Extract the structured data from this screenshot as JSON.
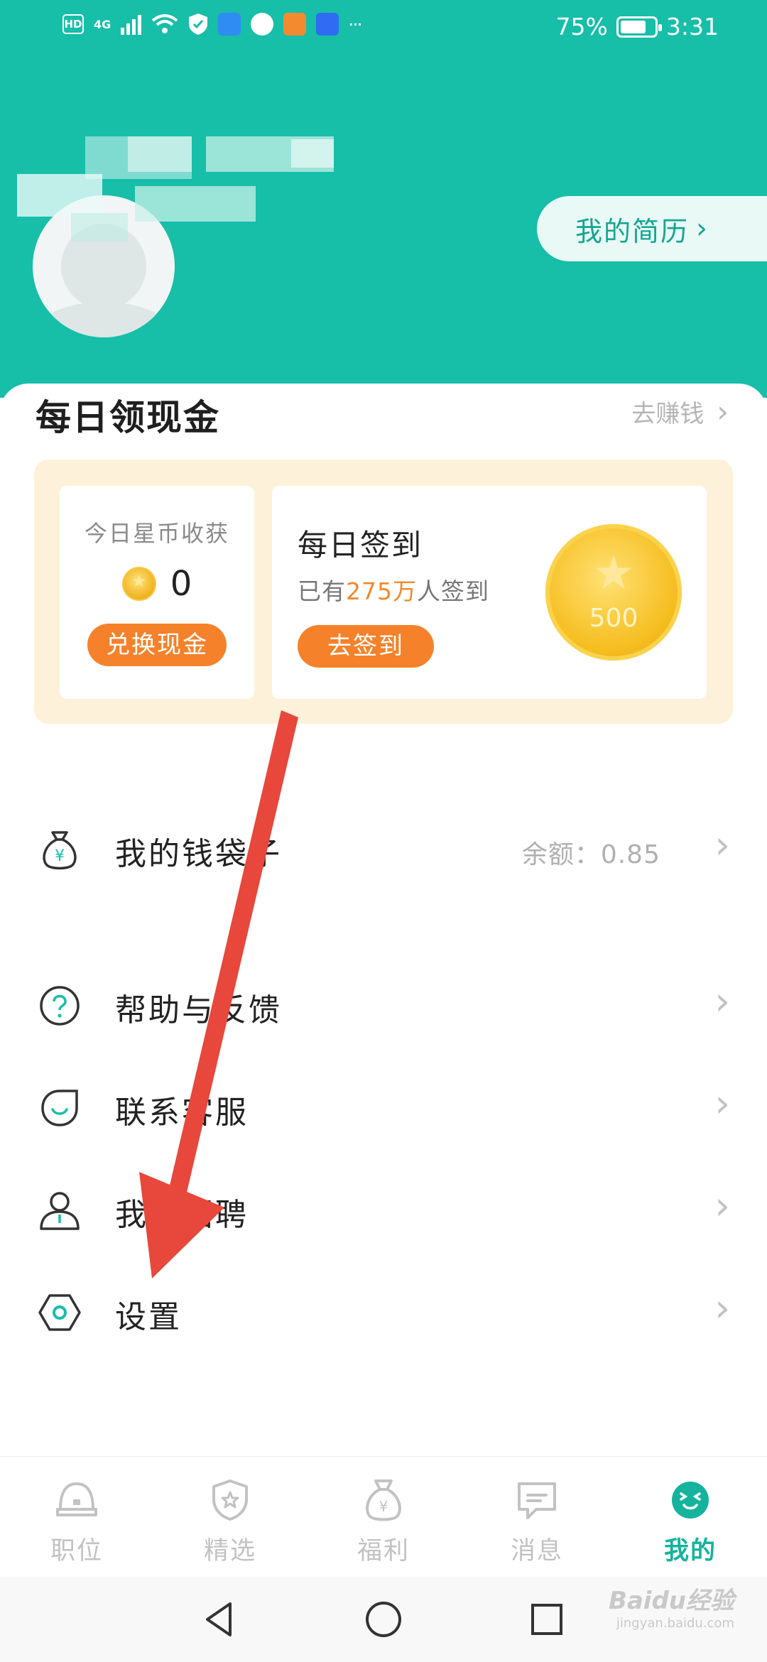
{
  "status_bar": {
    "hd": "HD",
    "net": "4G",
    "battery": "75%",
    "battery_level": 0.75,
    "time": "3:31",
    "more": "···"
  },
  "header": {
    "resume_button": "我的简历",
    "resume_chevron": "›"
  },
  "daily": {
    "title": "每日领现金",
    "earn_link": "去赚钱",
    "earn_chevron": "›",
    "today_label": "今日星币收获",
    "coins": "0",
    "exchange_button": "兑换现金",
    "checkin_title": "每日签到",
    "checkin_prefix": "已有",
    "checkin_count": "275万",
    "checkin_suffix": "人签到",
    "checkin_button": "去签到",
    "coin_value": "500"
  },
  "menu": {
    "wallet": {
      "label": "我的钱袋子",
      "extra": "余额：0.85",
      "icon": "money-bag-icon"
    },
    "help": {
      "label": "帮助与反馈",
      "icon": "question-icon"
    },
    "service": {
      "label": "联系客服",
      "icon": "chat-smile-icon"
    },
    "recruit": {
      "label": "我要招聘",
      "icon": "person-icon"
    },
    "settings": {
      "label": "设置",
      "icon": "hexagon-gear-icon"
    },
    "chevron": "›"
  },
  "tabs": [
    {
      "label": "职位",
      "icon": "job-icon"
    },
    {
      "label": "精选",
      "icon": "star-shield-icon"
    },
    {
      "label": "福利",
      "icon": "money-bag-icon"
    },
    {
      "label": "消息",
      "icon": "message-icon"
    },
    {
      "label": "我的",
      "icon": "smiley-icon"
    }
  ],
  "active_tab": "我的",
  "watermark": {
    "brand": "Baidu经验",
    "url": "jingyan.baidu.com"
  },
  "colors": {
    "accent": "#17bea8",
    "orange": "#f5822b",
    "arrow": "#e8473b"
  }
}
